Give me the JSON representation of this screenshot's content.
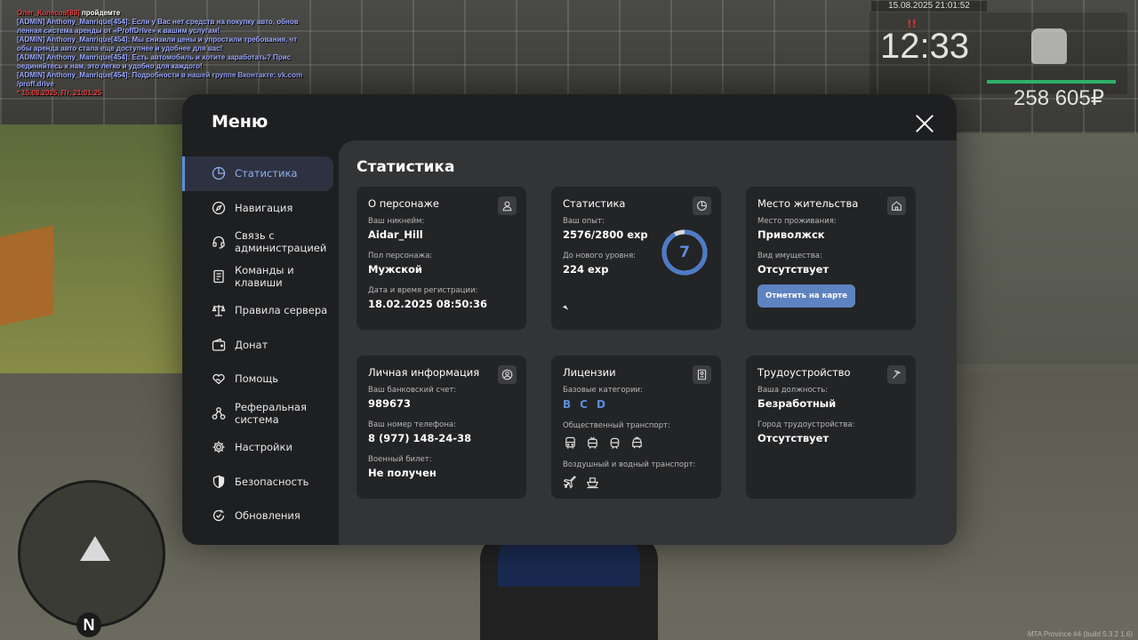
{
  "chat": {
    "line1_name": "Олег_Колесов[88]",
    "line1_text": " пройдемте",
    "line2": "[ADMIN] Anthony_Manrique[454]: Если у Вас нет средств на покупку авто, обнов",
    "line3": "ленная система аренды от «ProffDrive» к вашим услугам!",
    "line4": "[ADMIN] Anthony_Manrique[454]: Мы снизили цены и упростили требования, чт",
    "line5": "обы аренда авто стала еще доступнее и удобнее для вас!",
    "line6": "[ADMIN] Anthony_Manrique[454]: Есть автомобиль и хотите заработать? Прис",
    "line7": "оединяйтесь к нам, это легко и удобно для каждого!",
    "line8": "[ADMIN] Anthony_Manrique[454]: Подробности в нашей группе Вконтакте: vk.com",
    "line9": "/proff.drive",
    "line10": "* 15.08.2025, Пт, 21:01:25"
  },
  "hud": {
    "date": "15.08.2025 21:01:52",
    "time": "12:33",
    "alert": "!!",
    "money": "258 605₽",
    "compass": "N",
    "server": "MTA Province #4 (build 5.3.2 1.6)"
  },
  "menu": {
    "title": "Меню",
    "close_label": "",
    "nav": [
      {
        "label": "Статистика",
        "icon": "pie-chart-icon",
        "active": true
      },
      {
        "label": "Навигация",
        "icon": "compass-icon"
      },
      {
        "label": "Связь с\nадминистрацией",
        "icon": "headset-icon"
      },
      {
        "label": "Команды и\nклавиши",
        "icon": "document-icon"
      },
      {
        "label": "Правила сервера",
        "icon": "scales-icon"
      },
      {
        "label": "Донат",
        "icon": "wallet-icon"
      },
      {
        "label": "Помощь",
        "icon": "heart-hand-icon"
      },
      {
        "label": "Реферальная\nсистема",
        "icon": "network-icon"
      },
      {
        "label": "Настройки",
        "icon": "gear-icon"
      },
      {
        "label": "Безопасность",
        "icon": "shield-icon"
      },
      {
        "label": "Обновления",
        "icon": "refresh-check-icon"
      }
    ]
  },
  "content": {
    "title": "Статистика",
    "character": {
      "title": "О персонаже",
      "nickname_label": "Ваш никнейм:",
      "nickname": "Aidar_Hill",
      "gender_label": "Пол персонажа:",
      "gender": "Мужской",
      "reg_label": "Дата и время регистрации:",
      "reg": "18.02.2025 08:50:36"
    },
    "stats": {
      "title": "Статистика",
      "exp_label": "Ваш опыт:",
      "exp": "2576/2800 exp",
      "next_label": "До нового уровня:",
      "next": "224 exp",
      "level": "7",
      "progress": 0.92
    },
    "residence": {
      "title": "Место жительства",
      "place_label": "Место проживания:",
      "place": "Приволжск",
      "property_label": "Вид имущества:",
      "property": "Отсутствует",
      "map_button": "Отметить на карте"
    },
    "personal": {
      "title": "Личная информация",
      "bank_label": "Ваш банковский счет:",
      "bank": "989673",
      "phone_label": "Ваш номер телефона:",
      "phone": "8 (977) 148-24-38",
      "military_label": "Военный билет:",
      "military": "Не получен"
    },
    "licenses": {
      "title": "Лицензии",
      "basic_label": "Базовые категории:",
      "categories": [
        "B",
        "C",
        "D"
      ],
      "public_label": "Общественный транспорт:",
      "air_water_label": "Воздушный и водный транспорт:"
    },
    "employment": {
      "title": "Трудоустройство",
      "position_label": "Ваша должность:",
      "position": "Безработный",
      "city_label": "Город трудоустройства:",
      "city": "Отсутствует"
    }
  },
  "colors": {
    "accent": "#5d8de0",
    "button": "#5d83c0",
    "card": "#232426",
    "panel": "#333436",
    "modal": "#1e1f21"
  }
}
